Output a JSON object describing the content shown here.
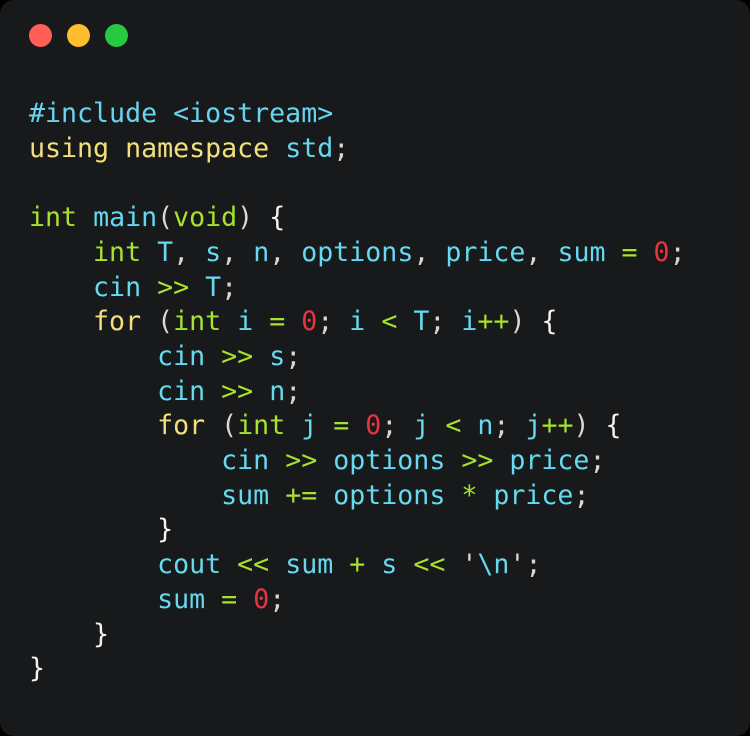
{
  "window": {
    "background_color": "#17191b",
    "outer_background_color": "#000000",
    "corner_radius_px": 14,
    "traffic_lights": [
      {
        "name": "close",
        "color": "#ff5f56"
      },
      {
        "name": "minimize",
        "color": "#ffbd2e"
      },
      {
        "name": "maximize",
        "color": "#27c93f"
      }
    ]
  },
  "editor": {
    "language": "C++",
    "font_size_px": 26.6,
    "line_height_px": 34.7,
    "indent_size": 4,
    "theme_colors": {
      "preprocessor": "#68d5f0",
      "keyword_type": "#a6e22e",
      "keyword_control": "#f4e07a",
      "identifier": "#66d9ef",
      "operator": "#a6e22e",
      "number": "#e8343f",
      "punctuation": "#d8d8d2",
      "brace": "#f2f2ee",
      "string": "#d8d8d2",
      "escape": "#66d9ef"
    },
    "code_text": "#include <iostream>\nusing namespace std;\n\nint main(void) {\n    int T, s, n, options, price, sum = 0;\n    cin >> T;\n    for (int i = 0; i < T; i++) {\n        cin >> s;\n        cin >> n;\n        for (int j = 0; j < n; j++) {\n            cin >> options >> price;\n            sum += options * price;\n        }\n        cout << sum + s << '\\n';\n        sum = 0;\n    }\n}",
    "lines": [
      {
        "n": 1,
        "indent": 0,
        "tokens": [
          {
            "t": "#include",
            "c": "pre"
          },
          {
            "t": " ",
            "c": "punc"
          },
          {
            "t": "<iostream>",
            "c": "pre"
          }
        ]
      },
      {
        "n": 2,
        "indent": 0,
        "tokens": [
          {
            "t": "using",
            "c": "kwc"
          },
          {
            "t": " ",
            "c": "punc"
          },
          {
            "t": "namespace",
            "c": "kwc"
          },
          {
            "t": " ",
            "c": "punc"
          },
          {
            "t": "std",
            "c": "id"
          },
          {
            "t": ";",
            "c": "punc"
          }
        ]
      },
      {
        "n": 3,
        "indent": 0,
        "tokens": []
      },
      {
        "n": 4,
        "indent": 0,
        "tokens": [
          {
            "t": "int",
            "c": "kw"
          },
          {
            "t": " ",
            "c": "punc"
          },
          {
            "t": "main",
            "c": "fn"
          },
          {
            "t": "(",
            "c": "punc"
          },
          {
            "t": "void",
            "c": "kw"
          },
          {
            "t": ")",
            "c": "punc"
          },
          {
            "t": " ",
            "c": "punc"
          },
          {
            "t": "{",
            "c": "brace"
          }
        ]
      },
      {
        "n": 5,
        "indent": 1,
        "tokens": [
          {
            "t": "int",
            "c": "kw"
          },
          {
            "t": " ",
            "c": "punc"
          },
          {
            "t": "T",
            "c": "id"
          },
          {
            "t": ", ",
            "c": "punc"
          },
          {
            "t": "s",
            "c": "id"
          },
          {
            "t": ", ",
            "c": "punc"
          },
          {
            "t": "n",
            "c": "id"
          },
          {
            "t": ", ",
            "c": "punc"
          },
          {
            "t": "options",
            "c": "id"
          },
          {
            "t": ", ",
            "c": "punc"
          },
          {
            "t": "price",
            "c": "id"
          },
          {
            "t": ", ",
            "c": "punc"
          },
          {
            "t": "sum",
            "c": "id"
          },
          {
            "t": " ",
            "c": "punc"
          },
          {
            "t": "=",
            "c": "op"
          },
          {
            "t": " ",
            "c": "punc"
          },
          {
            "t": "0",
            "c": "num"
          },
          {
            "t": ";",
            "c": "punc"
          }
        ]
      },
      {
        "n": 6,
        "indent": 1,
        "tokens": [
          {
            "t": "cin",
            "c": "id"
          },
          {
            "t": " ",
            "c": "punc"
          },
          {
            "t": ">>",
            "c": "op"
          },
          {
            "t": " ",
            "c": "punc"
          },
          {
            "t": "T",
            "c": "id"
          },
          {
            "t": ";",
            "c": "punc"
          }
        ]
      },
      {
        "n": 7,
        "indent": 1,
        "tokens": [
          {
            "t": "for",
            "c": "kwc"
          },
          {
            "t": " ",
            "c": "punc"
          },
          {
            "t": "(",
            "c": "punc"
          },
          {
            "t": "int",
            "c": "kw"
          },
          {
            "t": " ",
            "c": "punc"
          },
          {
            "t": "i",
            "c": "id"
          },
          {
            "t": " ",
            "c": "punc"
          },
          {
            "t": "=",
            "c": "op"
          },
          {
            "t": " ",
            "c": "punc"
          },
          {
            "t": "0",
            "c": "num"
          },
          {
            "t": "; ",
            "c": "punc"
          },
          {
            "t": "i",
            "c": "id"
          },
          {
            "t": " ",
            "c": "punc"
          },
          {
            "t": "<",
            "c": "op"
          },
          {
            "t": " ",
            "c": "punc"
          },
          {
            "t": "T",
            "c": "id"
          },
          {
            "t": "; ",
            "c": "punc"
          },
          {
            "t": "i",
            "c": "id"
          },
          {
            "t": "++",
            "c": "op"
          },
          {
            "t": ")",
            "c": "punc"
          },
          {
            "t": " ",
            "c": "punc"
          },
          {
            "t": "{",
            "c": "brace"
          }
        ]
      },
      {
        "n": 8,
        "indent": 2,
        "tokens": [
          {
            "t": "cin",
            "c": "id"
          },
          {
            "t": " ",
            "c": "punc"
          },
          {
            "t": ">>",
            "c": "op"
          },
          {
            "t": " ",
            "c": "punc"
          },
          {
            "t": "s",
            "c": "id"
          },
          {
            "t": ";",
            "c": "punc"
          }
        ]
      },
      {
        "n": 9,
        "indent": 2,
        "tokens": [
          {
            "t": "cin",
            "c": "id"
          },
          {
            "t": " ",
            "c": "punc"
          },
          {
            "t": ">>",
            "c": "op"
          },
          {
            "t": " ",
            "c": "punc"
          },
          {
            "t": "n",
            "c": "id"
          },
          {
            "t": ";",
            "c": "punc"
          }
        ]
      },
      {
        "n": 10,
        "indent": 2,
        "tokens": [
          {
            "t": "for",
            "c": "kwc"
          },
          {
            "t": " ",
            "c": "punc"
          },
          {
            "t": "(",
            "c": "punc"
          },
          {
            "t": "int",
            "c": "kw"
          },
          {
            "t": " ",
            "c": "punc"
          },
          {
            "t": "j",
            "c": "id"
          },
          {
            "t": " ",
            "c": "punc"
          },
          {
            "t": "=",
            "c": "op"
          },
          {
            "t": " ",
            "c": "punc"
          },
          {
            "t": "0",
            "c": "num"
          },
          {
            "t": "; ",
            "c": "punc"
          },
          {
            "t": "j",
            "c": "id"
          },
          {
            "t": " ",
            "c": "punc"
          },
          {
            "t": "<",
            "c": "op"
          },
          {
            "t": " ",
            "c": "punc"
          },
          {
            "t": "n",
            "c": "id"
          },
          {
            "t": "; ",
            "c": "punc"
          },
          {
            "t": "j",
            "c": "id"
          },
          {
            "t": "++",
            "c": "op"
          },
          {
            "t": ")",
            "c": "punc"
          },
          {
            "t": " ",
            "c": "punc"
          },
          {
            "t": "{",
            "c": "brace"
          }
        ]
      },
      {
        "n": 11,
        "indent": 3,
        "tokens": [
          {
            "t": "cin",
            "c": "id"
          },
          {
            "t": " ",
            "c": "punc"
          },
          {
            "t": ">>",
            "c": "op"
          },
          {
            "t": " ",
            "c": "punc"
          },
          {
            "t": "options",
            "c": "id"
          },
          {
            "t": " ",
            "c": "punc"
          },
          {
            "t": ">>",
            "c": "op"
          },
          {
            "t": " ",
            "c": "punc"
          },
          {
            "t": "price",
            "c": "id"
          },
          {
            "t": ";",
            "c": "punc"
          }
        ]
      },
      {
        "n": 12,
        "indent": 3,
        "tokens": [
          {
            "t": "sum",
            "c": "id"
          },
          {
            "t": " ",
            "c": "punc"
          },
          {
            "t": "+=",
            "c": "op"
          },
          {
            "t": " ",
            "c": "punc"
          },
          {
            "t": "options",
            "c": "id"
          },
          {
            "t": " ",
            "c": "punc"
          },
          {
            "t": "*",
            "c": "op"
          },
          {
            "t": " ",
            "c": "punc"
          },
          {
            "t": "price",
            "c": "id"
          },
          {
            "t": ";",
            "c": "punc"
          }
        ]
      },
      {
        "n": 13,
        "indent": 2,
        "tokens": [
          {
            "t": "}",
            "c": "brace"
          }
        ]
      },
      {
        "n": 14,
        "indent": 2,
        "tokens": [
          {
            "t": "cout",
            "c": "id"
          },
          {
            "t": " ",
            "c": "punc"
          },
          {
            "t": "<<",
            "c": "op"
          },
          {
            "t": " ",
            "c": "punc"
          },
          {
            "t": "sum",
            "c": "id"
          },
          {
            "t": " ",
            "c": "punc"
          },
          {
            "t": "+",
            "c": "op"
          },
          {
            "t": " ",
            "c": "punc"
          },
          {
            "t": "s",
            "c": "id"
          },
          {
            "t": " ",
            "c": "punc"
          },
          {
            "t": "<<",
            "c": "op"
          },
          {
            "t": " ",
            "c": "punc"
          },
          {
            "t": "'",
            "c": "str"
          },
          {
            "t": "\\n",
            "c": "esc"
          },
          {
            "t": "'",
            "c": "str"
          },
          {
            "t": ";",
            "c": "punc"
          }
        ]
      },
      {
        "n": 15,
        "indent": 2,
        "tokens": [
          {
            "t": "sum",
            "c": "id"
          },
          {
            "t": " ",
            "c": "punc"
          },
          {
            "t": "=",
            "c": "op"
          },
          {
            "t": " ",
            "c": "punc"
          },
          {
            "t": "0",
            "c": "num"
          },
          {
            "t": ";",
            "c": "punc"
          }
        ]
      },
      {
        "n": 16,
        "indent": 1,
        "tokens": [
          {
            "t": "}",
            "c": "brace"
          }
        ]
      },
      {
        "n": 17,
        "indent": 0,
        "tokens": [
          {
            "t": "}",
            "c": "brace"
          }
        ]
      }
    ]
  }
}
